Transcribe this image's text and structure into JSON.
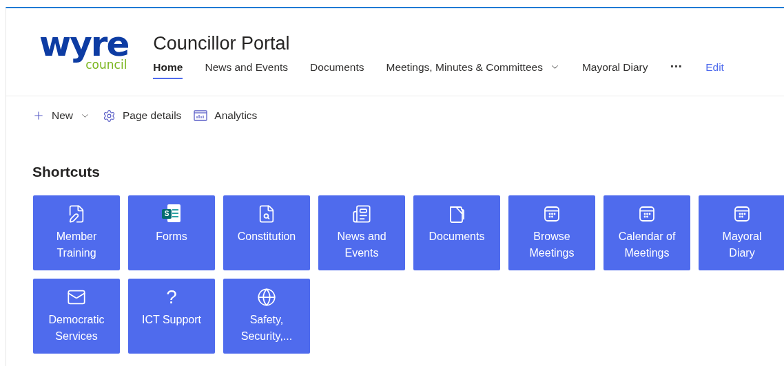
{
  "logo": {
    "word": "wyre",
    "subword": "council"
  },
  "site_title": "Councillor Portal",
  "nav": [
    {
      "label": "Home",
      "selected": true,
      "dropdown": false
    },
    {
      "label": "News and Events",
      "selected": false,
      "dropdown": false
    },
    {
      "label": "Documents",
      "selected": false,
      "dropdown": false
    },
    {
      "label": "Meetings, Minutes & Committees",
      "selected": false,
      "dropdown": true
    },
    {
      "label": "Mayoral Diary",
      "selected": false,
      "dropdown": false
    }
  ],
  "nav_more": "···",
  "edit_link": "Edit",
  "commands": [
    {
      "kind": "new",
      "label": "New"
    },
    {
      "kind": "details",
      "label": "Page details"
    },
    {
      "kind": "analytics",
      "label": "Analytics"
    }
  ],
  "shortcuts": {
    "title": "Shortcuts",
    "tiles": [
      {
        "kind": "training",
        "label": [
          "Member",
          "Training"
        ]
      },
      {
        "kind": "forms",
        "label": [
          "Forms"
        ],
        "icon_letter": "S"
      },
      {
        "kind": "constitution",
        "label": [
          "Constitution"
        ]
      },
      {
        "kind": "news",
        "label": [
          "News and",
          "Events"
        ]
      },
      {
        "kind": "documents",
        "label": [
          "Documents"
        ]
      },
      {
        "kind": "calendar",
        "label": [
          "Browse",
          "Meetings"
        ]
      },
      {
        "kind": "calendar",
        "label": [
          "Calendar of",
          "Meetings"
        ]
      },
      {
        "kind": "calendar",
        "label": [
          "Mayoral",
          "Diary"
        ]
      },
      {
        "kind": "mail",
        "label": [
          "Democratic",
          "Services"
        ]
      },
      {
        "kind": "question",
        "label": [
          "ICT Support"
        ],
        "icon_letter": "?"
      },
      {
        "kind": "globe",
        "label": [
          "Safety,",
          "Security,..."
        ]
      }
    ]
  }
}
